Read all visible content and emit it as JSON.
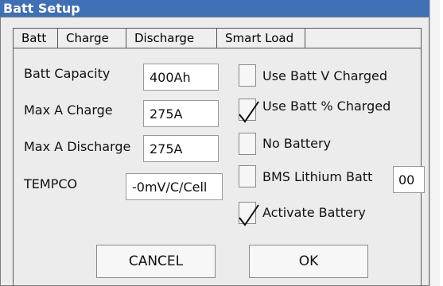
{
  "window": {
    "title": "Batt Setup"
  },
  "tabs": [
    {
      "label": "Batt"
    },
    {
      "label": "Charge"
    },
    {
      "label": "Discharge"
    },
    {
      "label": "Smart Load"
    }
  ],
  "fields": {
    "batt_capacity": {
      "label": "Batt Capacity",
      "value": "400Ah"
    },
    "max_a_charge": {
      "label": "Max A Charge",
      "value": "275A"
    },
    "max_a_discharge": {
      "label": "Max A Discharge",
      "value": "275A"
    },
    "tempco": {
      "label": "TEMPCO",
      "value": "-0mV/C/Cell"
    }
  },
  "options": {
    "use_batt_v_charged": {
      "label": "Use Batt V Charged",
      "checked": false
    },
    "use_batt_pct_charged": {
      "label": "Use Batt % Charged",
      "checked": true
    },
    "no_battery": {
      "label": "No Battery",
      "checked": false
    },
    "bms_lithium_batt": {
      "label": "BMS Lithium Batt",
      "checked": false,
      "value": "00"
    },
    "activate_battery": {
      "label": "Activate Battery",
      "checked": true
    }
  },
  "buttons": {
    "cancel": "CANCEL",
    "ok": "OK"
  }
}
